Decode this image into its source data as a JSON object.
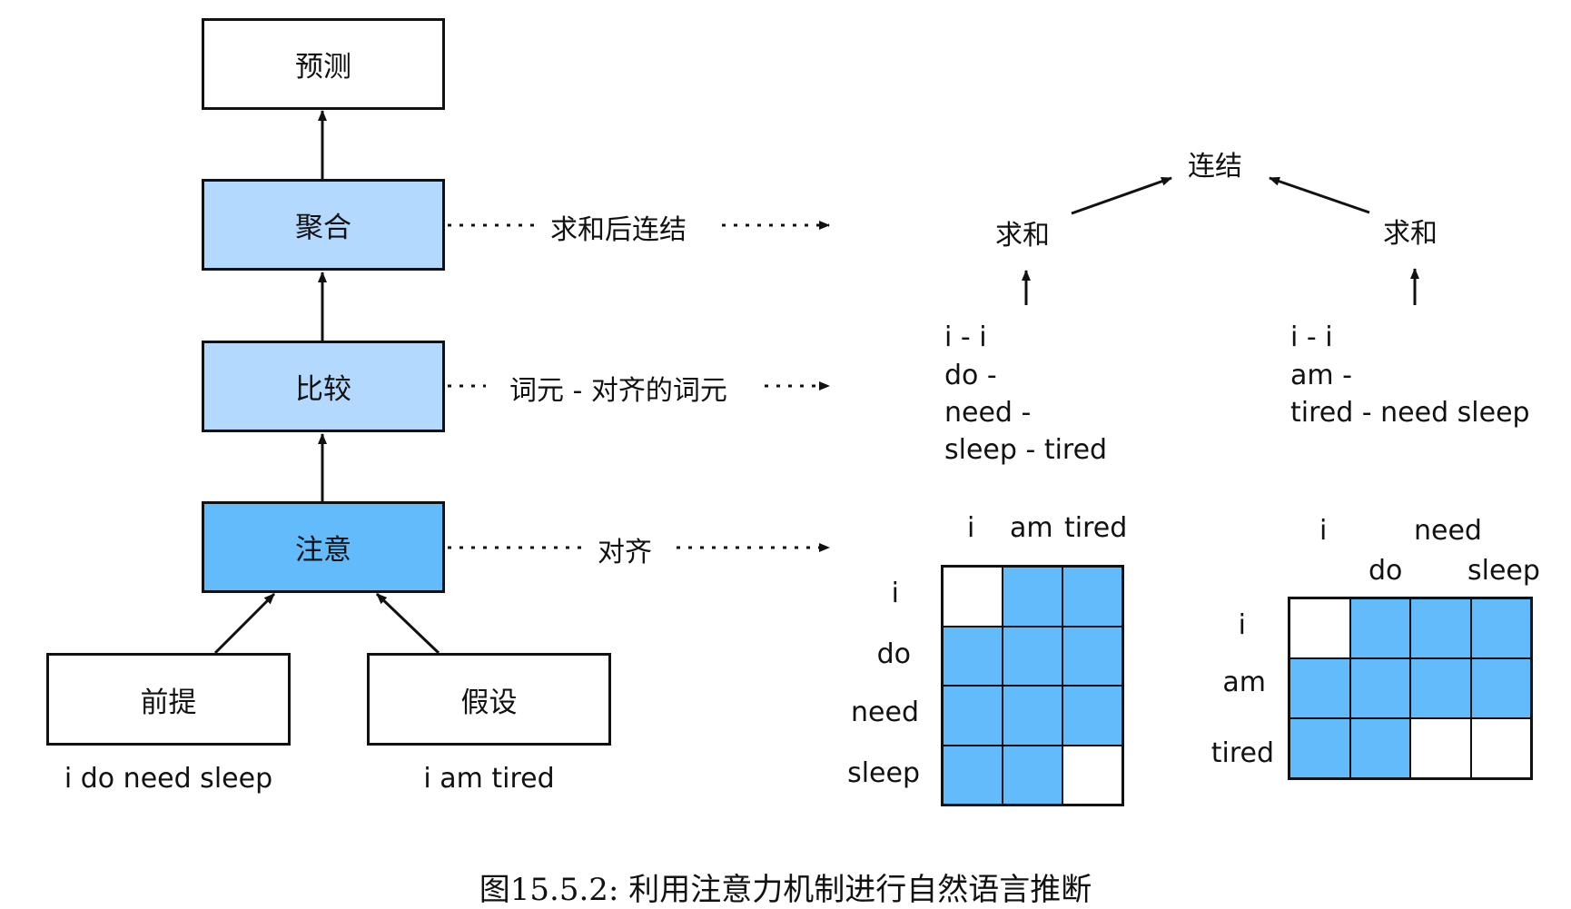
{
  "boxes": {
    "predict": "预测",
    "aggregate": "聚合",
    "compare": "比较",
    "attend": "注意",
    "premise": "前提",
    "hypothesis": "假设"
  },
  "inputs": {
    "premise_text": "i do need sleep",
    "hypothesis_text": "i am tired"
  },
  "dotted_labels": {
    "aggregate": "求和后连结",
    "compare": "词元 - 对齐的词元",
    "attend": "对齐"
  },
  "aggregate_view": {
    "concat": "连结",
    "sum_left": "求和",
    "sum_right": "求和"
  },
  "compare_view": {
    "left": [
      "i - i",
      "do -",
      "need -",
      "sleep - tired"
    ],
    "right": [
      "i - i",
      "am -",
      "tired - need sleep"
    ]
  },
  "align_left": {
    "cols": [
      "i",
      "am",
      "tired"
    ],
    "rows": [
      "i",
      "do",
      "need",
      "sleep"
    ],
    "cells": [
      [
        0,
        1,
        1
      ],
      [
        1,
        1,
        1
      ],
      [
        1,
        1,
        1
      ],
      [
        1,
        1,
        0
      ]
    ]
  },
  "align_right": {
    "cols": [
      "i",
      "do",
      "need",
      "sleep"
    ],
    "rows": [
      "i",
      "am",
      "tired"
    ],
    "cells": [
      [
        0,
        1,
        1,
        1
      ],
      [
        1,
        1,
        1,
        1
      ],
      [
        1,
        1,
        0,
        0
      ]
    ]
  },
  "caption": "图15.5.2: 利用注意力机制进行自然语言推断",
  "colors": {
    "light_blue": "#b3d9ff",
    "mid_blue": "#62bbfa",
    "stroke": "#111111"
  }
}
